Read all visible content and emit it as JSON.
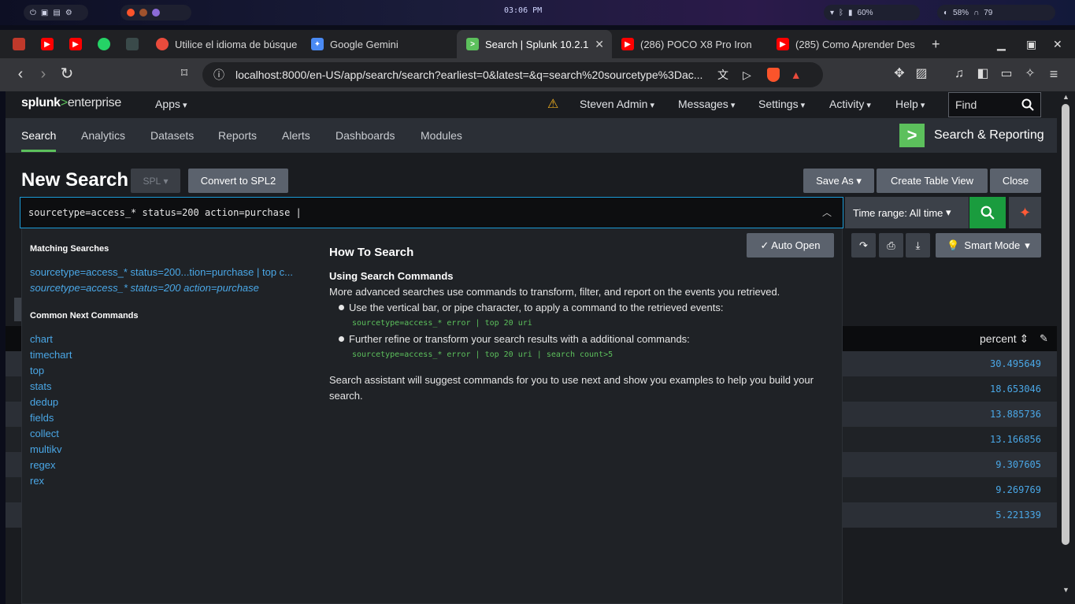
{
  "os": {
    "clock": "03:06 PM",
    "battery_left": "60%",
    "battery_right": "58%",
    "headset": "79"
  },
  "browser": {
    "tabs": [
      {
        "label": "Utilice el idioma de búsque",
        "fav_color": "#e94b3c"
      },
      {
        "label": "Google Gemini",
        "fav_color": "#4a8af4"
      },
      {
        "label": "Search | Splunk 10.2.1",
        "fav_color": "#5cc05c",
        "active": true
      },
      {
        "label": "(286) POCO X8 Pro Iron",
        "fav_color": "#ff0000"
      },
      {
        "label": "(285) Como Aprender Des",
        "fav_color": "#ff0000"
      }
    ],
    "url": "localhost:8000/en-US/app/search/search?earliest=0&latest=&q=search%20sourcetype%3Dac..."
  },
  "splunk": {
    "logo_main": "splunk",
    "logo_gt": ">",
    "logo_sub": "enterprise",
    "top_nav": {
      "apps": "Apps",
      "user": "Steven Admin",
      "messages": "Messages",
      "settings": "Settings",
      "activity": "Activity",
      "help": "Help",
      "find_placeholder": "Find"
    },
    "app_nav": [
      "Search",
      "Analytics",
      "Datasets",
      "Reports",
      "Alerts",
      "Dashboards",
      "Modules"
    ],
    "app_title": "Search & Reporting",
    "page_title": "New Search",
    "spl_label": "SPL",
    "convert_label": "Convert to SPL2",
    "save_as": "Save As",
    "create_table": "Create Table View",
    "close": "Close",
    "query": "sourcetype=access_* status=200 action=purchase |",
    "time_range": "Time range: All time",
    "smart_mode": "Smart Mode",
    "auto_open": "✓ Auto Open"
  },
  "assistant": {
    "matching_title": "Matching Searches",
    "matching": [
      "sourcetype=access_* status=200...tion=purchase | top c...",
      "sourcetype=access_* status=200 action=purchase"
    ],
    "common_title": "Common Next Commands",
    "commands": [
      "chart",
      "timechart",
      "top",
      "stats",
      "dedup",
      "fields",
      "collect",
      "multikv",
      "regex",
      "rex"
    ],
    "howto_title": "How To Search",
    "using_title": "Using Search Commands",
    "intro": "More advanced searches use commands to transform, filter, and report on the events you retrieved.",
    "bullet1": "Use the vertical bar, or pipe character, to apply a command to the retrieved events:",
    "example1": "sourcetype=access_* error | top 20 uri",
    "bullet2": "Further refine or transform your search results with a additional commands:",
    "example2": "sourcetype=access_* error | top 20 uri | search count>5",
    "outro": "Search assistant will suggest commands for you to use next and show you examples to help you build your search."
  },
  "results": {
    "column": "percent",
    "values": [
      "30.495649",
      "18.653046",
      "13.885736",
      "13.166856",
      "9.307605",
      "9.269769",
      "5.221339"
    ]
  }
}
